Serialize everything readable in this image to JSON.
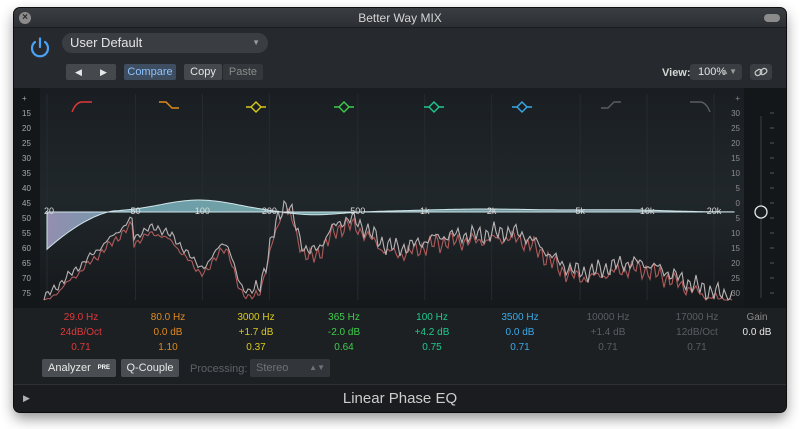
{
  "window": {
    "title": "Better Way MIX"
  },
  "header": {
    "preset_name": "User Default",
    "prev_glyph": "◀",
    "next_glyph": "▶",
    "compare_label": "Compare",
    "copy_label": "Copy",
    "paste_label": "Paste",
    "view_label": "View:",
    "view_value": "100%"
  },
  "graph": {
    "left_scale": [
      "+",
      "15",
      "20",
      "25",
      "30",
      "35",
      "40",
      "45",
      "50",
      "55",
      "60",
      "65",
      "70",
      "75",
      "-"
    ],
    "right_scale": [
      "+",
      "30",
      "25",
      "20",
      "15",
      "10",
      "5",
      "0",
      "5",
      "10",
      "15",
      "20",
      "25",
      "30",
      "-"
    ],
    "freq_labels": [
      "20",
      "50",
      "100",
      "200",
      "500",
      "1k",
      "2k",
      "5k",
      "10k",
      "20k"
    ],
    "band_icons": [
      "low-cut-icon",
      "low-shelf-icon",
      "bell-icon",
      "bell-icon",
      "bell-icon",
      "bell-icon",
      "high-shelf-icon",
      "high-cut-icon"
    ]
  },
  "bands": [
    {
      "freq": "29.0 Hz",
      "gain": "24dB/Oct",
      "q": "0.71",
      "color": "#e0393a"
    },
    {
      "freq": "80.0 Hz",
      "gain": "0.0 dB",
      "q": "1.10",
      "color": "#e08a1e"
    },
    {
      "freq": "3000 Hz",
      "gain": "+1.7 dB",
      "q": "0.37",
      "color": "#d8c91c"
    },
    {
      "freq": "365 Hz",
      "gain": "-2.0 dB",
      "q": "0.64",
      "color": "#3ecc4c"
    },
    {
      "freq": "100 Hz",
      "gain": "+4.2 dB",
      "q": "0.75",
      "color": "#1ec98c"
    },
    {
      "freq": "3500 Hz",
      "gain": "0.0 dB",
      "q": "0.71",
      "color": "#3aa9e8"
    },
    {
      "freq": "10000 Hz",
      "gain": "+1.4 dB",
      "q": "0.71",
      "color": "#5a5d61"
    },
    {
      "freq": "17000 Hz",
      "gain": "12dB/Oct",
      "q": "0.71",
      "color": "#5a5d61"
    }
  ],
  "master": {
    "label": "Gain",
    "value": "0.0 dB"
  },
  "footer": {
    "analyzer_label": "Analyzer",
    "analyzer_badge": "PRE",
    "qcouple_label": "Q-Couple",
    "processing_label": "Processing:",
    "processing_value": "Stereo"
  },
  "plugin_name": "Linear Phase EQ"
}
